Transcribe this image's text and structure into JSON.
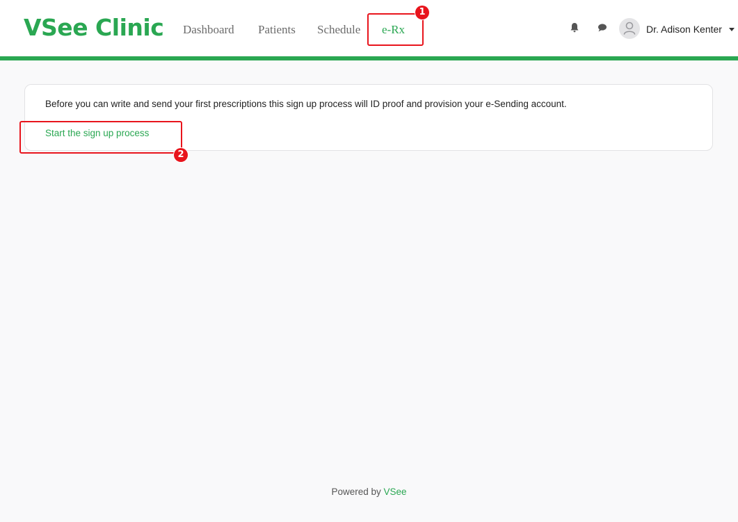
{
  "header": {
    "logo": "VSee Clinic",
    "nav": [
      {
        "label": "Dashboard"
      },
      {
        "label": "Patients"
      },
      {
        "label": "Schedule"
      },
      {
        "label": "e-Rx",
        "active": true
      }
    ],
    "icons": [
      "bell-icon",
      "chat-icon"
    ],
    "user": {
      "name": "Dr. Adison Kenter",
      "avatar_icon": "user-icon"
    }
  },
  "annotations": [
    {
      "number": "1",
      "target": "nav e-Rx"
    },
    {
      "number": "2",
      "target": "Start the sign up process link"
    }
  ],
  "main": {
    "message": "Before you can write and send your first prescriptions this sign up process will ID proof and provision your e-Sending account.",
    "link": "Start the sign up process"
  },
  "footer": {
    "prefix": "Powered by ",
    "brand": "VSee"
  },
  "colors": {
    "brand": "#2aa752",
    "annotation": "#e8141c",
    "background": "#f9f9fa"
  }
}
